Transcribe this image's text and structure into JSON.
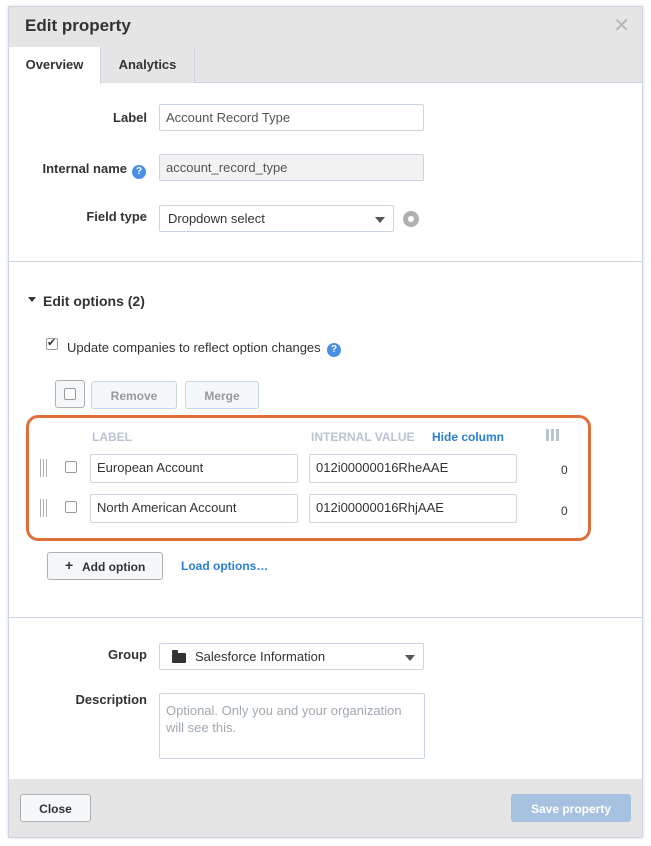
{
  "dialog": {
    "title": "Edit property",
    "close_icon": "close-icon"
  },
  "tabs": [
    {
      "label": "Overview",
      "active": true
    },
    {
      "label": "Analytics",
      "active": false
    }
  ],
  "fields": {
    "label_label": "Label",
    "label_value": "Account Record Type",
    "internal_name_label": "Internal name",
    "internal_name_value": "account_record_type",
    "field_type_label": "Field type",
    "field_type_value": "Dropdown select"
  },
  "edit_options": {
    "title": "Edit options (2)",
    "update_checkbox_label": "Update companies to reflect option changes",
    "update_checked": true,
    "remove_label": "Remove",
    "merge_label": "Merge",
    "col_label": "LABEL",
    "col_internal_value": "INTERNAL VALUE",
    "hide_column_label": "Hide column",
    "rows": [
      {
        "label": "European Account",
        "internal_value": "012i00000016RheAAE",
        "count": "0"
      },
      {
        "label": "North American Account",
        "internal_value": "012i00000016RhjAAE",
        "count": "0"
      }
    ],
    "add_option_label": "Add option",
    "load_options_label": "Load options…"
  },
  "group": {
    "label": "Group",
    "value": "Salesforce Information"
  },
  "description": {
    "label": "Description",
    "placeholder": "Optional. Only you and your organization will see this."
  },
  "footer": {
    "close_label": "Close",
    "save_label": "Save property"
  },
  "colors": {
    "highlight_border": "#e0703a",
    "link": "#2a7fd4",
    "primary_disabled": "#a7c1e0"
  }
}
